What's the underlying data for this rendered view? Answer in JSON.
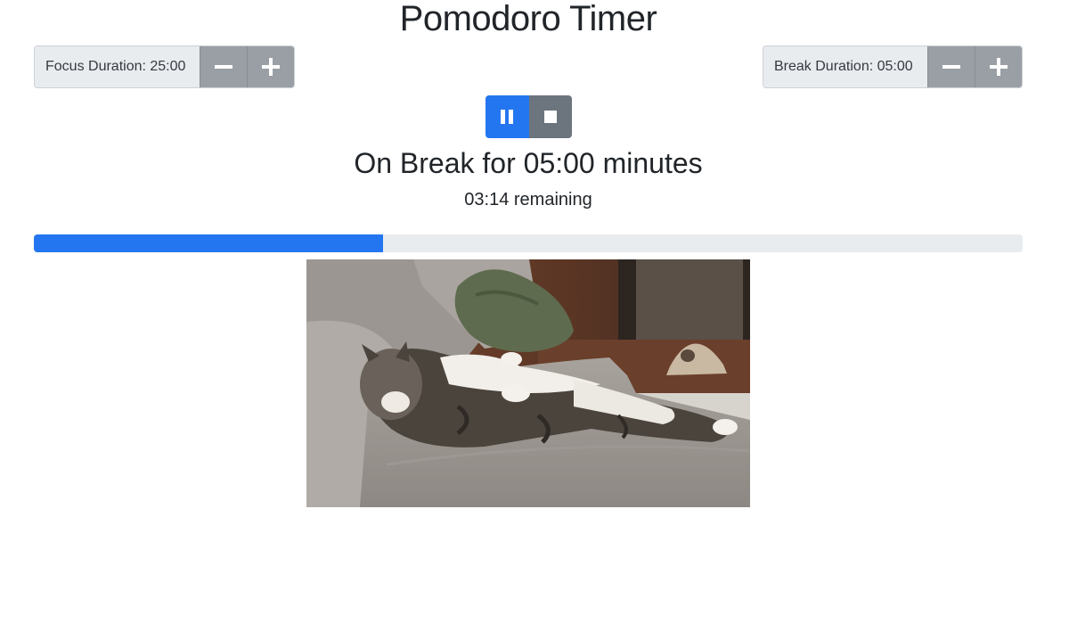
{
  "app": {
    "title": "Pomodoro Timer"
  },
  "focus": {
    "label": "Focus Duration: 25:00",
    "decrement_icon": "minus-icon",
    "increment_icon": "plus-icon"
  },
  "break": {
    "label": "Break Duration: 05:00",
    "decrement_icon": "minus-icon",
    "increment_icon": "plus-icon"
  },
  "controls": {
    "pause_icon": "pause-icon",
    "stop_icon": "stop-icon"
  },
  "status": {
    "heading": "On Break for 05:00 minutes",
    "remaining": "03:14 remaining"
  },
  "progress": {
    "fraction": 0.353
  },
  "image": {
    "subject": "cat-lying-on-couch"
  },
  "colors": {
    "primary": "#2476f0",
    "secondary": "#6c757d",
    "step_button": "#999fa5",
    "track": "#e9ecef"
  }
}
